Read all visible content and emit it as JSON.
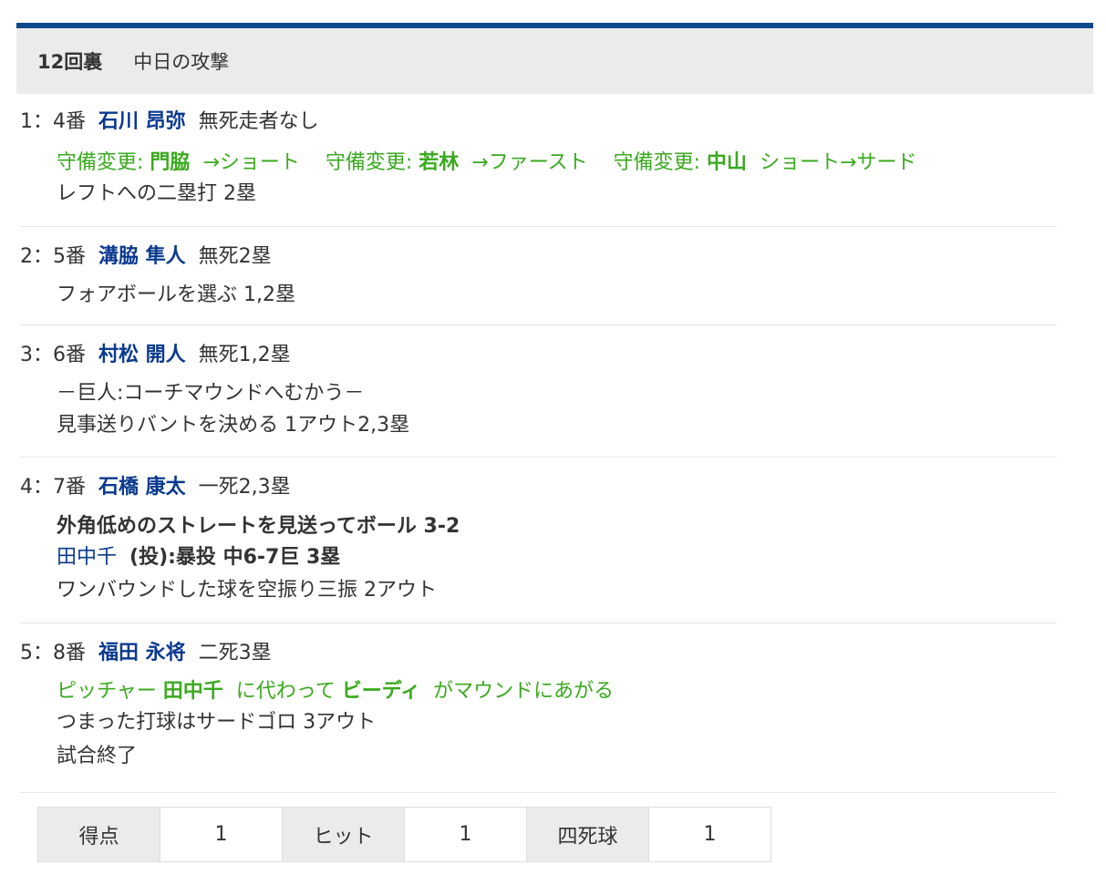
{
  "header": {
    "inning": "12回裏",
    "team_attack": "中日の攻撃"
  },
  "at_bats": [
    {
      "prefix": "1：4番",
      "player": "石川 昂弥",
      "situation": "無死走者なし",
      "defense_changes": [
        {
          "label": "守備変更:",
          "player": "門脇",
          "position": "→ショート"
        },
        {
          "label": "守備変更:",
          "player": "若林",
          "position": "→ファースト"
        },
        {
          "label": "守備変更:",
          "player": "中山",
          "position": "ショート→サード"
        }
      ],
      "result": "レフトへの二塁打 2塁"
    },
    {
      "prefix": "2：5番",
      "player": "溝脇 隼人",
      "situation": "無死2塁",
      "result": "フォアボールを選ぶ 1,2塁"
    },
    {
      "prefix": "3：6番",
      "player": "村松 開人",
      "situation": "無死1,2塁",
      "note": "－巨人:コーチマウンドへむかう－",
      "result": "見事送りバントを決める 1アウト2,3塁"
    },
    {
      "prefix": "4：7番",
      "player": "石橋 康太",
      "situation": "一死2,3塁",
      "pitch": "外角低めのストレートを見送ってボール 3-2",
      "error_pitcher": "田中千",
      "error_text": "(投):暴投 中6-7巨 3塁",
      "result": "ワンバウンドした球を空振り三振 2アウト"
    },
    {
      "prefix": "5：8番",
      "player": "福田 永将",
      "situation": "二死3塁",
      "change_pre": "ピッチャー",
      "change_from": "田中千",
      "change_mid": "に代わって",
      "change_to": "ビーディ",
      "change_post": "がマウンドにあがる",
      "result": "つまった打球はサードゴロ 3アウト",
      "end": "試合終了"
    }
  ],
  "summary": {
    "runs_label": "得点",
    "runs": "1",
    "hits_label": "ヒット",
    "hits": "1",
    "walks_label": "四死球",
    "walks": "1"
  }
}
